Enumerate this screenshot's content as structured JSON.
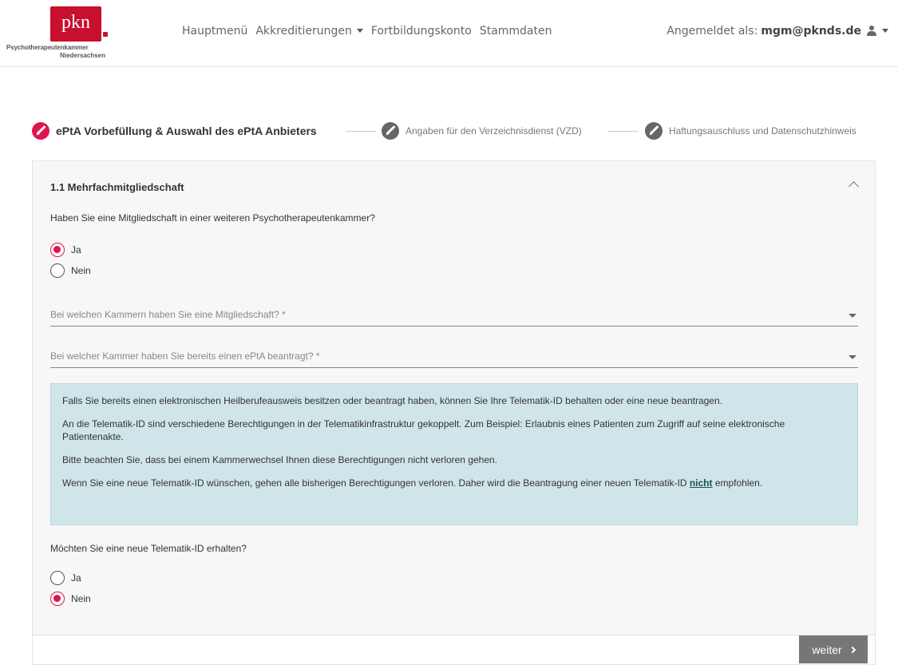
{
  "logo": {
    "mark": "pkn",
    "line1": "Psychotherapeutenkammer",
    "line2": "Niedersachsen"
  },
  "nav": {
    "items": [
      {
        "label": "Hauptmenü"
      },
      {
        "label": "Akkreditierungen"
      },
      {
        "label": "Fortbildungskonto"
      },
      {
        "label": "Stammdaten"
      }
    ]
  },
  "user": {
    "prefix": "Angemeldet als:",
    "email": "mgm@pknds.de"
  },
  "stepper": {
    "steps": [
      {
        "label": "ePtA Vorbefüllung & Auswahl des ePtA Anbieters",
        "active": true
      },
      {
        "label": "Angaben für den Verzeichnisdienst (VZD)",
        "active": false
      },
      {
        "label": "Haftungsauschluss und Datenschutzhinweis",
        "active": false
      }
    ]
  },
  "section": {
    "title": "1.1 Mehrfachmitgliedschaft",
    "question1": "Haben Sie eine Mitgliedschaft in einer weiteren Psychotherapeutenkammer?",
    "q1_options": [
      {
        "label": "Ja",
        "checked": true
      },
      {
        "label": "Nein",
        "checked": false
      }
    ],
    "select1_label": "Bei welchen Kammern haben Sie eine Mitgliedschaft? *",
    "select2_label": "Bei welcher Kammer haben Sie bereits einen ePtA beantragt? *",
    "info": {
      "p1": "Falls Sie bereits einen elektronischen Heilberufeausweis besitzen oder beantragt haben, können Sie Ihre Telematik-ID behalten oder eine neue beantragen.",
      "p2": "An die Telematik-ID sind verschiedene Berechtigungen in der Telematikinfrastruktur gekoppelt. Zum Beispiel: Erlaubnis eines Patienten zum Zugriff auf seine elektronische Patientenakte.",
      "p3": "Bitte beachten Sie, dass bei einem Kammerwechsel Ihnen diese Berechtigungen nicht verloren gehen.",
      "p4_before": "Wenn Sie eine neue Telematik-ID wünschen, gehen alle bisherigen Berechtigungen verloren. Daher wird die Beantragung einer neuen Telematik-ID ",
      "p4_emphasis": "nicht",
      "p4_after": " empfohlen."
    },
    "question2": "Möchten Sie eine neue Telematik-ID erhalten?",
    "q2_options": [
      {
        "label": "Ja",
        "checked": false
      },
      {
        "label": "Nein",
        "checked": true
      }
    ]
  },
  "footer": {
    "next_label": "weiter"
  },
  "colors": {
    "accent": "#e0134f",
    "brand": "#c8102e",
    "info_bg": "#cfe5e9",
    "button_bg": "#767676"
  }
}
